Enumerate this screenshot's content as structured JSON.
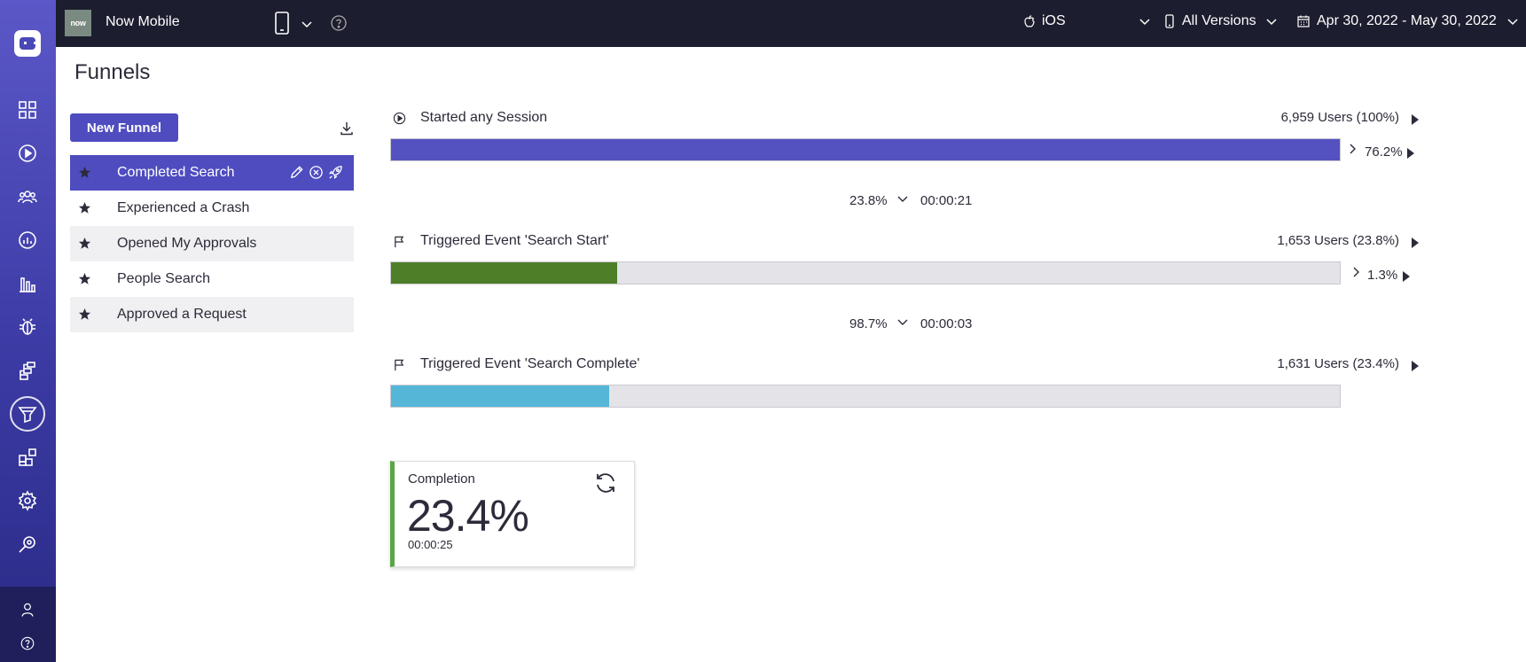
{
  "header": {
    "app_logo_text": "now",
    "app_name": "Now Mobile",
    "platform": "iOS",
    "versions": "All Versions",
    "date_range": "Apr 30, 2022 - May 30, 2022"
  },
  "page": {
    "title": "Funnels",
    "new_funnel_label": "New Funnel"
  },
  "funnels": [
    {
      "label": "Completed Search",
      "selected": true
    },
    {
      "label": "Experienced a Crash",
      "selected": false
    },
    {
      "label": "Opened My Approvals",
      "selected": false
    },
    {
      "label": "People Search",
      "selected": false
    },
    {
      "label": "Approved a Request",
      "selected": false
    }
  ],
  "steps": [
    {
      "name": "Started any Session",
      "users": "6,959 Users (100%)",
      "fraction": 1.0,
      "color": "#5452c0",
      "next_conversion": "76.2%"
    },
    {
      "name": "Triggered Event 'Search Start'",
      "users": "1,653 Users (23.8%)",
      "fraction": 0.238,
      "color": "#4e7f28",
      "next_conversion": "1.3%"
    },
    {
      "name": "Triggered Event 'Search Complete'",
      "users": "1,631 Users (23.4%)",
      "fraction": 0.23,
      "color": "#55b6d8"
    }
  ],
  "transitions": [
    {
      "percent": "23.8%",
      "time": "00:00:21"
    },
    {
      "percent": "98.7%",
      "time": "00:00:03"
    }
  ],
  "completion": {
    "title": "Completion",
    "value": "23.4%",
    "time": "00:00:25",
    "accent": "#5aa545"
  },
  "rail_icons": [
    "dashboard-icon",
    "sessions-play-icon",
    "users-icon",
    "analytics-icon",
    "bar-chart-icon",
    "bug-icon",
    "flows-icon",
    "funnel-icon",
    "widgets-icon",
    "settings-gear-icon",
    "inspect-icon",
    "profile-icon",
    "help-icon"
  ]
}
